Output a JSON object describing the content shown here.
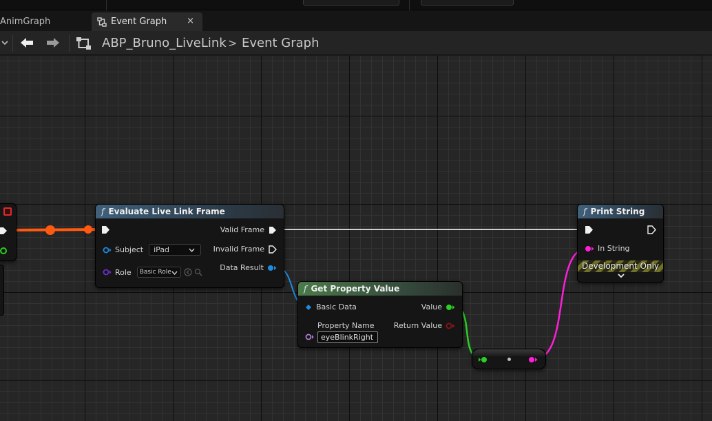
{
  "tabs": [
    {
      "label": "AnimGraph",
      "active": false
    },
    {
      "label": "Event Graph",
      "active": true,
      "close": "×"
    }
  ],
  "breadcrumb": {
    "items": [
      "ABP_Bruno_LiveLink",
      "Event Graph"
    ],
    "separator": ">"
  },
  "nodes": {
    "evaluate": {
      "title": "Evaluate Live Link Frame",
      "pins": {
        "subject_label": "Subject",
        "subject_value": "iPad",
        "role_label": "Role",
        "role_value": "Basic Role",
        "valid_frame": "Valid Frame",
        "invalid_frame": "Invalid Frame",
        "data_result": "Data Result"
      }
    },
    "get_property": {
      "title": "Get Property Value",
      "pins": {
        "basic_data": "Basic Data",
        "value": "Value",
        "property_name": "Property Name",
        "property_value": "eyeBlinkRight",
        "return_value": "Return Value"
      }
    },
    "print_string": {
      "title": "Print String",
      "pins": {
        "in_string": "In String",
        "dev_only": "Development Only"
      }
    }
  },
  "colors": {
    "exec_wire": "#ff5a10",
    "exec_link": "#cfcfcf",
    "struct_pin": "#1f8be0",
    "float_pin": "#29d021",
    "string_pin": "#ff1fd8",
    "bool_pin": "#8c1414",
    "name_pin": "#b07ad8",
    "enum_pin": "#6a2fd0"
  }
}
